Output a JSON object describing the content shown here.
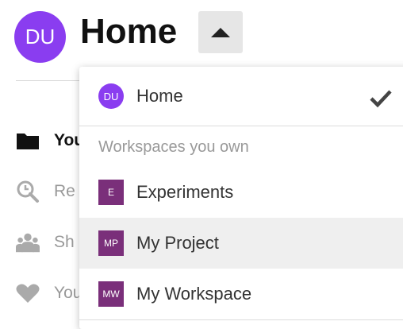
{
  "header": {
    "avatar_initials": "DU",
    "title": "Home",
    "toggle_icon": "caret-up-icon"
  },
  "sidebar": {
    "items": [
      {
        "label": "You",
        "icon": "folder-icon"
      },
      {
        "label": "Re",
        "icon": "search-clock-icon"
      },
      {
        "label": "Sh",
        "icon": "people-icon"
      },
      {
        "label": "You",
        "icon": "heart-icon"
      }
    ]
  },
  "dropdown": {
    "home": {
      "avatar_initials": "DU",
      "label": "Home",
      "selected_icon": "checkmark-icon"
    },
    "section_header": "Workspaces you own",
    "workspaces": [
      {
        "badge": "E",
        "label": "Experiments"
      },
      {
        "badge": "MP",
        "label": "My Project"
      },
      {
        "badge": "MW",
        "label": "My Workspace"
      }
    ]
  },
  "colors": {
    "avatar": "#8a3df0",
    "workspace_badge": "#7a2f7a",
    "hover_row": "#efefef"
  }
}
